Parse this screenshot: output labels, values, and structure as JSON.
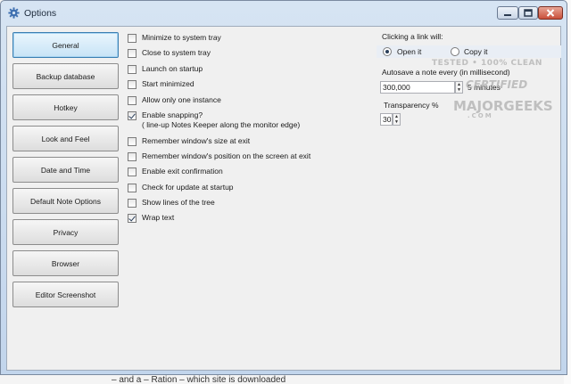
{
  "window": {
    "title": "Options",
    "controls": {
      "minimize_icon": "minimize-icon",
      "maximize_icon": "maximize-icon",
      "close_icon": "close-icon"
    }
  },
  "nav": {
    "items": [
      {
        "label": "General",
        "active": true
      },
      {
        "label": "Backup database"
      },
      {
        "label": "Hotkey"
      },
      {
        "label": "Look and Feel"
      },
      {
        "label": "Date and Time"
      },
      {
        "label": "Default Note Options"
      },
      {
        "label": "Privacy"
      },
      {
        "label": "Browser"
      },
      {
        "label": "Editor Screenshot"
      }
    ]
  },
  "general": {
    "options": [
      {
        "label": "Minimize to system tray",
        "checked": false
      },
      {
        "label": "Close to system tray",
        "checked": false
      },
      {
        "label": "Launch on startup",
        "checked": false
      },
      {
        "label": "Start minimized",
        "checked": false
      },
      {
        "label": "Allow only one instance",
        "checked": false
      },
      {
        "label": "Enable snapping?",
        "sublabel": "( line-up Notes Keeper along the monitor edge)",
        "checked": true
      },
      {
        "label": "Remember window's size at exit",
        "checked": false
      },
      {
        "label": "Remember window's position on the screen at exit",
        "checked": false
      },
      {
        "label": "Enable exit confirmation",
        "checked": false
      },
      {
        "label": "Check for update at startup",
        "checked": false
      },
      {
        "label": "Show lines of the tree",
        "checked": false
      },
      {
        "label": "Wrap text",
        "checked": true
      }
    ],
    "link": {
      "label": "Clicking a link will:",
      "open_label": "Open it",
      "copy_label": "Copy it",
      "selected": "open"
    },
    "autosave": {
      "label": "Autosave a note every (in millisecond)",
      "value": "300,000",
      "unit": "5 minutes"
    },
    "transparency": {
      "label": "Transparency %",
      "value": "30"
    }
  },
  "watermark": {
    "line1": "TESTED • 100% CLEAN",
    "line2": "CERTIFIED",
    "line3": "MAJORGEEKS",
    "line4": ".COM"
  },
  "background": {
    "partial_text": "– and a – Ration – which site is downloaded"
  }
}
